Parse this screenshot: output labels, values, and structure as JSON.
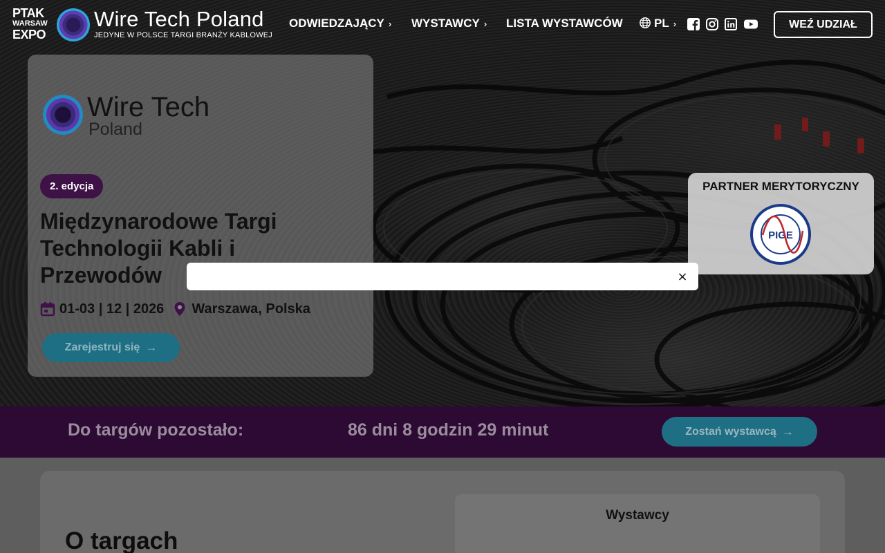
{
  "header": {
    "ptak_logo": {
      "line1": "PTAK",
      "line2": "WARSAW",
      "line3": "EXPO"
    },
    "brand_title": "Wire Tech Poland",
    "brand_tagline": "JEDYNE W POLSCE TARGI BRANŻY KABLOWEJ",
    "nav": [
      {
        "label": "ODWIEDZAJĄCY",
        "has_chevron": true
      },
      {
        "label": "WYSTAWCY",
        "has_chevron": true
      },
      {
        "label": "LISTA WYSTAWCÓW",
        "has_chevron": false
      }
    ],
    "language": "PL",
    "social_icons": [
      "facebook-icon",
      "instagram-icon",
      "linkedin-icon",
      "youtube-icon"
    ],
    "cta_label": "WEŹ UDZIAŁ"
  },
  "hero": {
    "logo_line1": "Wire Tech",
    "logo_line2": "Poland",
    "edition_badge": "2. edycja",
    "title": "Międzynarodowe Targi Technologii Kabli i Przewodów",
    "date": "01-03 | 12 | 2026",
    "location": "Warszawa, Polska",
    "register_label": "Zarejestruj się"
  },
  "partner": {
    "title": "PARTNER MERYTORYCZNY",
    "logo_text": "PIGE",
    "ring_text": "POLSKA IZBA GOSPODARCZA ELEKTROTECHNIKI"
  },
  "modal": {
    "close_label": "×"
  },
  "countdown": {
    "label": "Do targów pozostało:",
    "value": "86 dni 8 godzin 29 minut",
    "button_label": "Zostań wystawcą"
  },
  "about": {
    "title": "O targach",
    "panel_title": "Wystawcy"
  },
  "colors": {
    "accent_purple": "#3e1147",
    "strip_purple": "#2c0a33",
    "teal_button": "#1f6f84"
  }
}
